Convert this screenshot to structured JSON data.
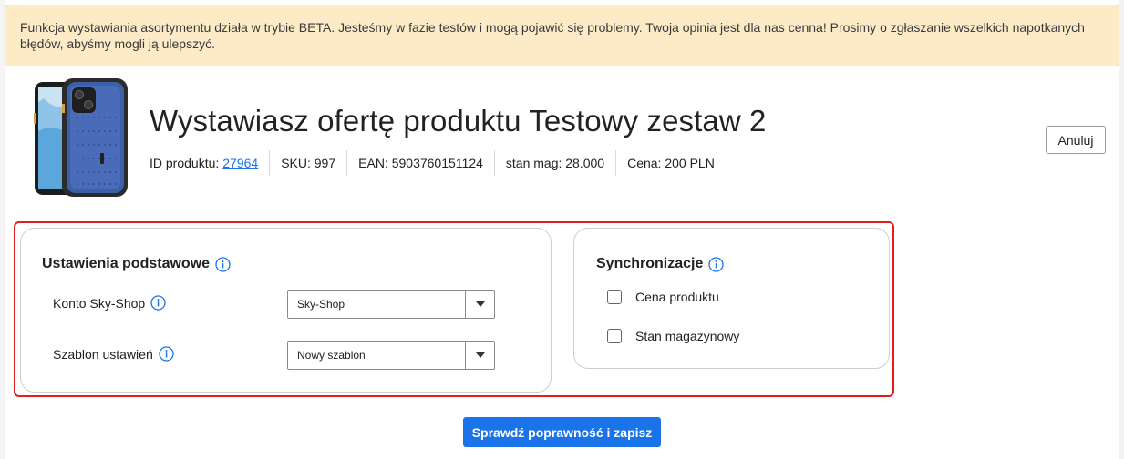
{
  "banner": {
    "text": "Funkcja wystawiania asortymentu działa w trybie BETA. Jesteśmy w fazie testów i mogą pojawić się problemy. Twoja opinia jest dla nas cenna! Prosimy o zgłaszanie wszelkich napotkanych błędów, abyśmy mogli ją ulepszyć."
  },
  "header": {
    "title": "Wystawiasz ofertę produktu Testowy zestaw 2",
    "cancel_label": "Anuluj",
    "meta": {
      "id_label": "ID produktu:",
      "id_value": "27964",
      "sku": "SKU: 997",
      "ean": "EAN: 5903760151124",
      "stock": "stan mag: 28.000",
      "price": "Cena: 200 PLN"
    }
  },
  "basic_settings": {
    "title": "Ustawienia podstawowe",
    "account_label": "Konto Sky-Shop",
    "account_value": "Sky-Shop",
    "template_label": "Szablon ustawień",
    "template_value": "Nowy szablon"
  },
  "sync": {
    "title": "Synchronizacje",
    "options": [
      {
        "label": "Cena produktu",
        "checked": false
      },
      {
        "label": "Stan magazynowy",
        "checked": false
      }
    ]
  },
  "footer": {
    "save_label": "Sprawdź poprawność i zapisz"
  },
  "colors": {
    "accent": "#1a73e8",
    "banner_bg": "#fdebc8",
    "highlight": "#e11d1d"
  }
}
